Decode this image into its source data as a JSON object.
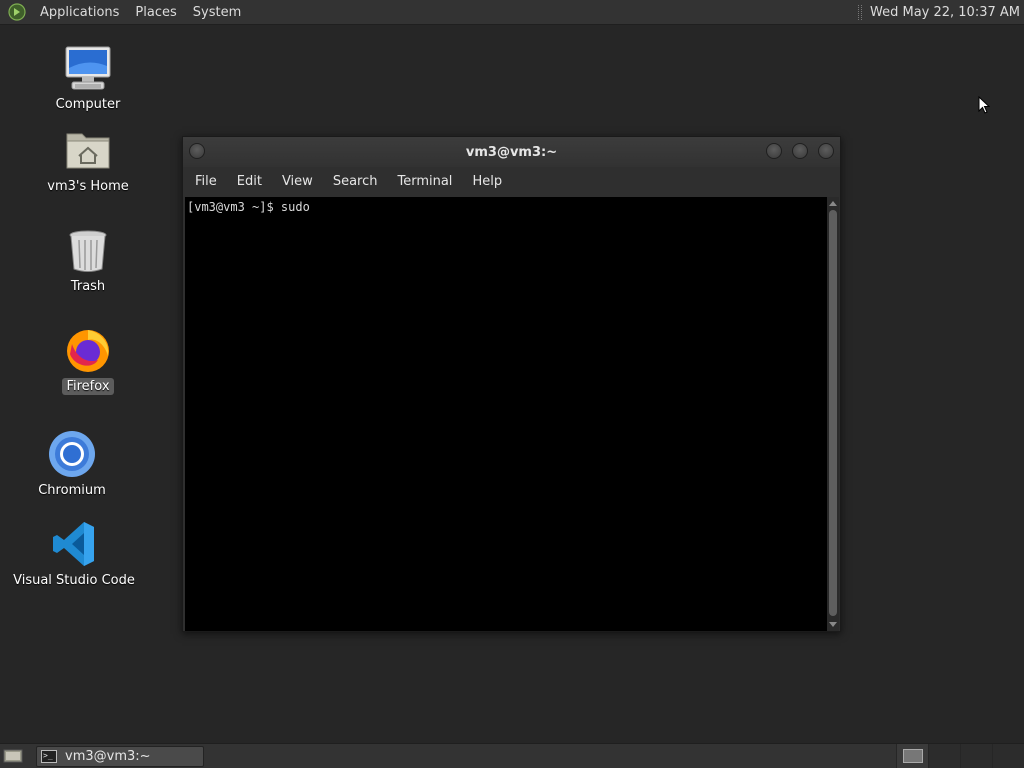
{
  "top_panel": {
    "menus": [
      "Applications",
      "Places",
      "System"
    ],
    "clock": "Wed May 22, 10:37 AM"
  },
  "desktop_icons": [
    {
      "label": "Computer",
      "icon": "computer-icon"
    },
    {
      "label": "vm3's Home",
      "icon": "home-folder-icon"
    },
    {
      "label": "Trash",
      "icon": "trash-icon"
    },
    {
      "label": "Firefox",
      "icon": "firefox-icon",
      "selected": true
    },
    {
      "label": "Chromium",
      "icon": "chromium-icon"
    },
    {
      "label": "Visual Studio Code",
      "icon": "vscode-icon"
    }
  ],
  "terminal": {
    "title": "vm3@vm3:~",
    "menu": [
      "File",
      "Edit",
      "View",
      "Search",
      "Terminal",
      "Help"
    ],
    "content": "[vm3@vm3 ~]$ sudo"
  },
  "taskbar": {
    "tasks": [
      {
        "label": "vm3@vm3:~",
        "icon": "terminal-icon"
      }
    ]
  },
  "colors": {
    "desktop_bg": "#262626",
    "panel_bg": "#333333",
    "terminal_bg": "#000000"
  }
}
